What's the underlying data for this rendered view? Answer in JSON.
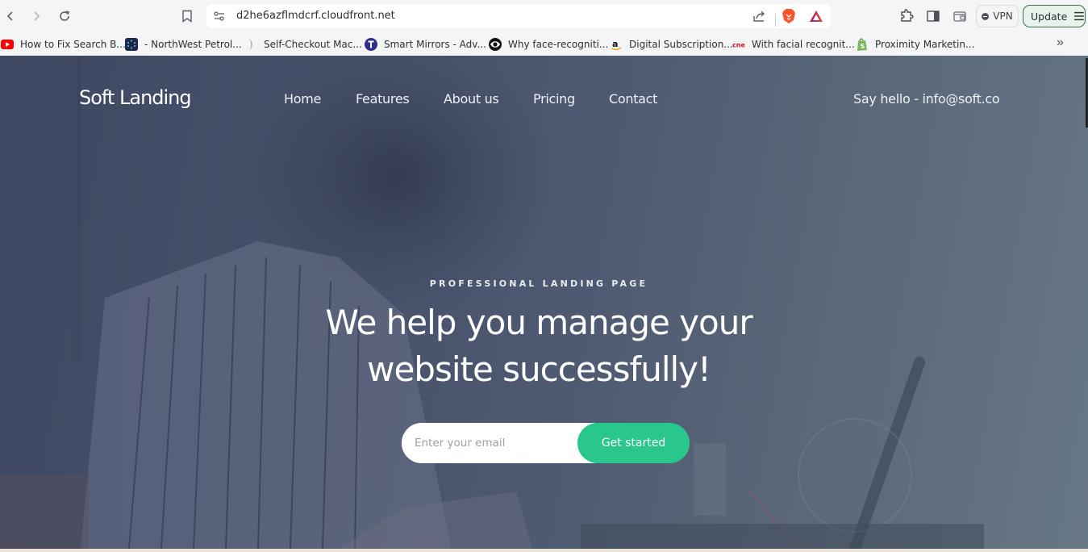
{
  "browser": {
    "url": "d2he6azflmdcrf.cloudfront.net",
    "vpn_label": "VPN",
    "update_label": "Update",
    "icons": {
      "back": "chevron-left-icon",
      "forward": "chevron-right-icon",
      "reload": "reload-icon",
      "bookmark": "bookmark-icon",
      "site_settings": "tune-icon",
      "share": "share-icon",
      "brave_shields": "brave-lion-icon",
      "brave_rewards": "triangle-icon",
      "extensions": "puzzle-icon",
      "sidebar": "sidebar-icon",
      "wallet": "wallet-icon",
      "menu": "hamburger-icon"
    }
  },
  "bookmarks": [
    {
      "label": "How to Fix Search B...",
      "icon": "youtube-icon",
      "color": "#ff0000"
    },
    {
      "label": "- NorthWest Petrol...",
      "icon": "dots-circle-icon",
      "color": "#1c2a4a"
    },
    {
      "label": "Self-Checkout Mac...",
      "icon": "generic-site-icon",
      "color": "#9aa0a6"
    },
    {
      "label": "Smart Mirrors - Adv...",
      "icon": "letter-t-icon",
      "color": "#2d2f8f"
    },
    {
      "label": "Why face-recogniti...",
      "icon": "eye-icon",
      "color": "#111111"
    },
    {
      "label": "Digital Subscription...",
      "icon": "amazon-icon",
      "color": "#f5a623"
    },
    {
      "label": "With facial recognit...",
      "icon": "cnet-icon",
      "color": "#d4101a"
    },
    {
      "label": "Proximity Marketin...",
      "icon": "shopify-icon",
      "color": "#7ab55c"
    }
  ],
  "bookmarks_overflow": "»",
  "site": {
    "brand": "Soft Landing",
    "nav": [
      "Home",
      "Features",
      "About us",
      "Pricing",
      "Contact"
    ],
    "contact_text": "Say hello - info@soft.co",
    "eyebrow": "PROFESSIONAL LANDING PAGE",
    "headline_line1": "We help you manage your",
    "headline_line2": "website successfully!",
    "email_placeholder": "Enter your email",
    "email_value": "",
    "cta_label": "Get started",
    "colors": {
      "accent": "#2ac78c",
      "overlay_dark": "#3f4862",
      "overlay_light": "#667785"
    }
  }
}
